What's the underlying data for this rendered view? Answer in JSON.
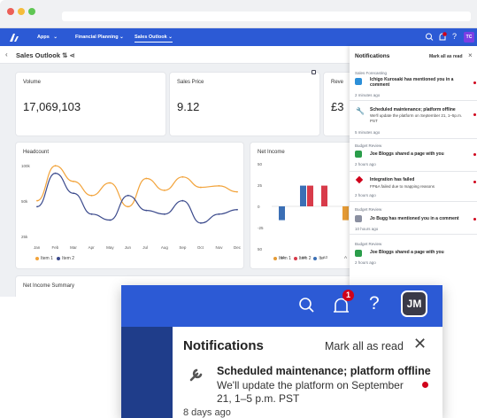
{
  "nav": {
    "apps": "Apps",
    "financial_planning": "Financial Planning",
    "sales_outlook": "Sales Outlook",
    "avatar": "TC"
  },
  "page": {
    "title": "Sales Outlook"
  },
  "kpis": [
    {
      "label": "Volume",
      "value": "17,069,103"
    },
    {
      "label": "Sales Price",
      "value": "9.12"
    },
    {
      "label": "Reve",
      "value": "£3"
    }
  ],
  "headcount": {
    "title": "Headcount",
    "legend": [
      "Item 1",
      "Item 2"
    ],
    "colors": {
      "item1": "#f2a33a",
      "item2": "#3b4a8c"
    }
  },
  "net_income": {
    "title": "Net Income",
    "legend": [
      "Item 1",
      "Item 2",
      "Ite"
    ],
    "colors": {
      "item1": "#e59b35",
      "item2": "#d83b4a",
      "item3": "#3b6fb5"
    }
  },
  "summary": {
    "title": "Net Income Summary"
  },
  "chart_data": [
    {
      "type": "line",
      "title": "Headcount",
      "categories": [
        "Jan",
        "Feb",
        "Mar",
        "Apr",
        "May",
        "Jun",
        "Jul",
        "Aug",
        "Sep",
        "Oct",
        "Nov",
        "Dec"
      ],
      "yticks": [
        "100k",
        "50k",
        "25k"
      ],
      "series": [
        {
          "name": "Item 1",
          "values": [
            48,
            95,
            74,
            55,
            72,
            40,
            78,
            62,
            80,
            66,
            68,
            60
          ]
        },
        {
          "name": "Item 2",
          "values": [
            40,
            85,
            58,
            30,
            22,
            55,
            35,
            30,
            48,
            18,
            30,
            36
          ]
        }
      ]
    },
    {
      "type": "bar",
      "title": "Net Income",
      "categories": [
        "a1",
        "a2",
        "a3",
        "A",
        "b1"
      ],
      "yticks": [
        "50",
        "25",
        "0",
        "-25",
        "50"
      ],
      "series": [
        {
          "name": "Item 1",
          "values": [
            0,
            0,
            0,
            -12,
            0
          ]
        },
        {
          "name": "Item 2",
          "values": [
            0,
            18,
            18,
            0,
            0
          ]
        },
        {
          "name": "Ite",
          "values": [
            -12,
            18,
            0,
            0,
            0
          ]
        }
      ]
    }
  ],
  "notifications": {
    "title": "Notifications",
    "mark_all": "Mark all as read",
    "items": [
      {
        "category": "Sales Forecasting",
        "message": "Ichigo Kurosaki has mentioned you in a comment",
        "detail": "",
        "time": "2 minutes ago",
        "icon": "user-icon",
        "unread": true
      },
      {
        "category": "",
        "message": "Scheduled maintenance; platform offline",
        "detail": "We'll update the platform on September 21, 1–5p.m. PST",
        "time": "5 minutes ago",
        "icon": "wrench-icon",
        "unread": true
      },
      {
        "category": "Budget Review",
        "message": "Joe Bloggs shared a page with you",
        "detail": "",
        "time": "2 hours ago",
        "icon": "share-icon",
        "unread": true
      },
      {
        "category": "",
        "message": "Integration has failed",
        "detail": "FP&A failed due to mapping reasons",
        "time": "2 hours ago",
        "icon": "error-icon",
        "unread": true
      },
      {
        "category": "Budget Review",
        "message": "Jo Bugg has mentioned you in a comment",
        "detail": "",
        "time": "10 hours ago",
        "icon": "user-icon",
        "unread": true
      },
      {
        "category": "Budget Review",
        "message": "Joe Bloggs shared a page with you",
        "detail": "",
        "time": "2 hours ago",
        "icon": "share-icon",
        "unread": false
      }
    ]
  },
  "zoom": {
    "avatar": "JM",
    "badge": "1",
    "title": "Notifications",
    "mark_all": "Mark all as read",
    "message": "Scheduled maintenance; platform offline",
    "detail": "We'll update the platform on September 21, 1–5 p.m. PST",
    "time": "8 days ago"
  }
}
